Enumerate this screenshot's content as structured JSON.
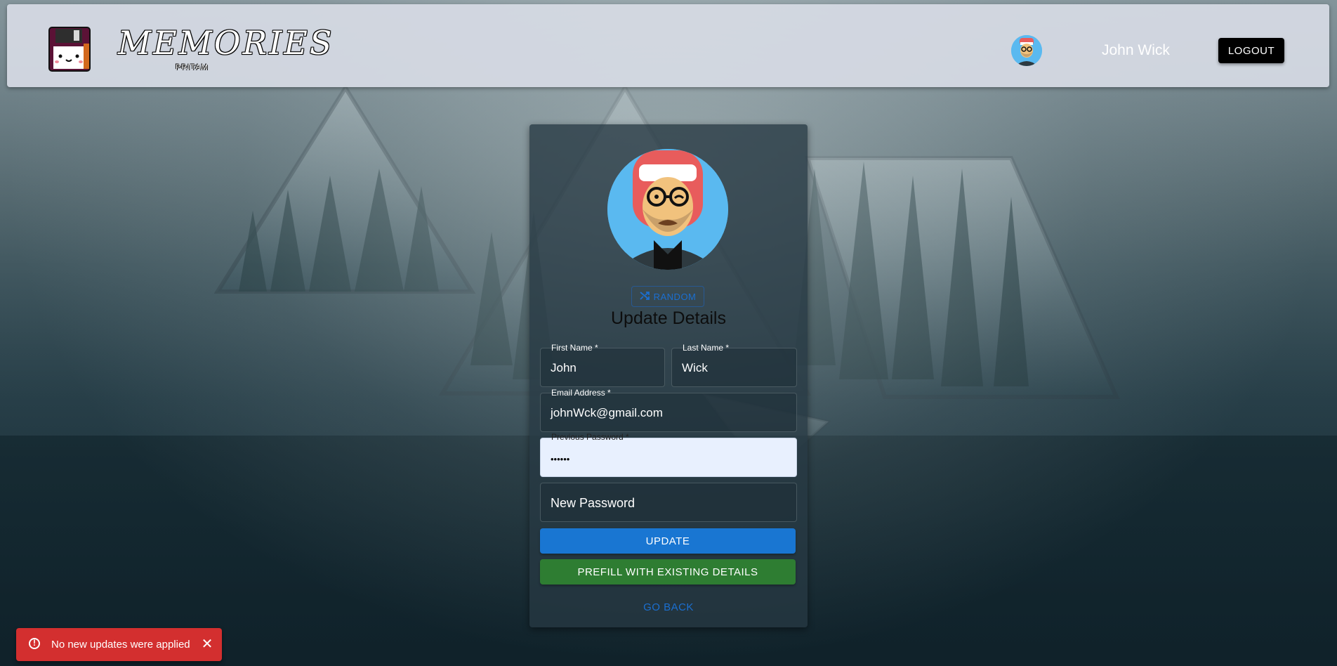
{
  "brand": {
    "title": "MEMORIES",
    "subtitle": "PRITAM",
    "logo_icon": "floppy-disk-icon"
  },
  "navbar": {
    "username": "John Wick",
    "logout_label": "LOGOUT",
    "avatar_icon": "user-avatar-icon"
  },
  "card": {
    "random_label": "RANDOM",
    "random_icon": "shuffle-icon",
    "title": "Update Details",
    "fields": {
      "first_name": {
        "label": "First Name *",
        "value": "John"
      },
      "last_name": {
        "label": "Last Name *",
        "value": "Wick"
      },
      "email": {
        "label": "Email Address *",
        "value": "johnWck@gmail.com"
      },
      "previous_password": {
        "label": "Previous Password *",
        "value": "••••••"
      },
      "new_password": {
        "placeholder": "New Password"
      }
    },
    "update_label": "UPDATE",
    "prefill_label": "PREFILL WITH EXISTING DETAILS",
    "go_back_label": "GO BACK"
  },
  "toast": {
    "message": "No new updates were applied",
    "icon": "error-outline-icon",
    "close_icon": "close-icon",
    "color": "#d32f2f"
  },
  "colors": {
    "primary": "#1976d2",
    "success": "#2e7d32",
    "error": "#d32f2f"
  }
}
